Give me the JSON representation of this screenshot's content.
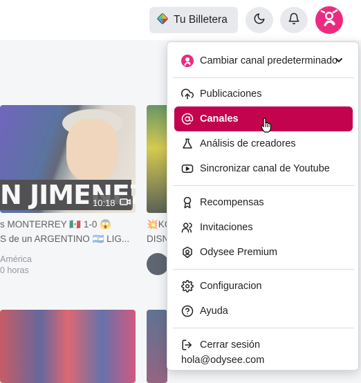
{
  "header": {
    "wallet_label": "Tu Billetera"
  },
  "feed": {
    "video1": {
      "title_line1": "s MONTERREY 🇲🇽 1-0 😱",
      "title_line2": "S de un ARGENTINO 🇦🇷 LIG...",
      "channel": "América",
      "age": "0 horas",
      "duration": "10:18",
      "thumb_text": "N JIMENEZ\""
    },
    "video2": {
      "title_line1": "💥KO",
      "title_line2": "DISN"
    }
  },
  "menu": {
    "default_channel_label": "Cambiar canal predeterminado",
    "items": [
      {
        "label": "Publicaciones",
        "icon": "upload-cloud-icon"
      },
      {
        "label": "Canales",
        "icon": "at-sign-icon"
      },
      {
        "label": "Análisis de creadores",
        "icon": "flask-icon"
      },
      {
        "label": "Sincronizar canal de Youtube",
        "icon": "youtube-icon"
      },
      {
        "label": "Recompensas",
        "icon": "award-icon"
      },
      {
        "label": "Invitaciones",
        "icon": "users-icon"
      },
      {
        "label": "Odysee Premium",
        "icon": "premium-badge-icon"
      },
      {
        "label": "Configuracion",
        "icon": "gear-icon"
      },
      {
        "label": "Ayuda",
        "icon": "help-icon"
      }
    ],
    "logout_label": "Cerrar sesión",
    "email": "hola@odysee.com"
  },
  "colors": {
    "accent": "#c4034f",
    "brand_pink": "#ec2a7f"
  }
}
